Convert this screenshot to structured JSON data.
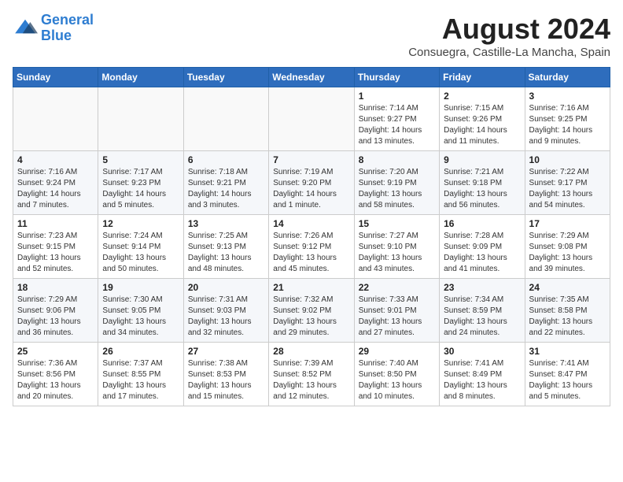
{
  "logo": {
    "line1": "General",
    "line2": "Blue"
  },
  "title": "August 2024",
  "subtitle": "Consuegra, Castille-La Mancha, Spain",
  "days_header": [
    "Sunday",
    "Monday",
    "Tuesday",
    "Wednesday",
    "Thursday",
    "Friday",
    "Saturday"
  ],
  "weeks": [
    [
      {
        "day": "",
        "info": ""
      },
      {
        "day": "",
        "info": ""
      },
      {
        "day": "",
        "info": ""
      },
      {
        "day": "",
        "info": ""
      },
      {
        "day": "1",
        "info": "Sunrise: 7:14 AM\nSunset: 9:27 PM\nDaylight: 14 hours\nand 13 minutes."
      },
      {
        "day": "2",
        "info": "Sunrise: 7:15 AM\nSunset: 9:26 PM\nDaylight: 14 hours\nand 11 minutes."
      },
      {
        "day": "3",
        "info": "Sunrise: 7:16 AM\nSunset: 9:25 PM\nDaylight: 14 hours\nand 9 minutes."
      }
    ],
    [
      {
        "day": "4",
        "info": "Sunrise: 7:16 AM\nSunset: 9:24 PM\nDaylight: 14 hours\nand 7 minutes."
      },
      {
        "day": "5",
        "info": "Sunrise: 7:17 AM\nSunset: 9:23 PM\nDaylight: 14 hours\nand 5 minutes."
      },
      {
        "day": "6",
        "info": "Sunrise: 7:18 AM\nSunset: 9:21 PM\nDaylight: 14 hours\nand 3 minutes."
      },
      {
        "day": "7",
        "info": "Sunrise: 7:19 AM\nSunset: 9:20 PM\nDaylight: 14 hours\nand 1 minute."
      },
      {
        "day": "8",
        "info": "Sunrise: 7:20 AM\nSunset: 9:19 PM\nDaylight: 13 hours\nand 58 minutes."
      },
      {
        "day": "9",
        "info": "Sunrise: 7:21 AM\nSunset: 9:18 PM\nDaylight: 13 hours\nand 56 minutes."
      },
      {
        "day": "10",
        "info": "Sunrise: 7:22 AM\nSunset: 9:17 PM\nDaylight: 13 hours\nand 54 minutes."
      }
    ],
    [
      {
        "day": "11",
        "info": "Sunrise: 7:23 AM\nSunset: 9:15 PM\nDaylight: 13 hours\nand 52 minutes."
      },
      {
        "day": "12",
        "info": "Sunrise: 7:24 AM\nSunset: 9:14 PM\nDaylight: 13 hours\nand 50 minutes."
      },
      {
        "day": "13",
        "info": "Sunrise: 7:25 AM\nSunset: 9:13 PM\nDaylight: 13 hours\nand 48 minutes."
      },
      {
        "day": "14",
        "info": "Sunrise: 7:26 AM\nSunset: 9:12 PM\nDaylight: 13 hours\nand 45 minutes."
      },
      {
        "day": "15",
        "info": "Sunrise: 7:27 AM\nSunset: 9:10 PM\nDaylight: 13 hours\nand 43 minutes."
      },
      {
        "day": "16",
        "info": "Sunrise: 7:28 AM\nSunset: 9:09 PM\nDaylight: 13 hours\nand 41 minutes."
      },
      {
        "day": "17",
        "info": "Sunrise: 7:29 AM\nSunset: 9:08 PM\nDaylight: 13 hours\nand 39 minutes."
      }
    ],
    [
      {
        "day": "18",
        "info": "Sunrise: 7:29 AM\nSunset: 9:06 PM\nDaylight: 13 hours\nand 36 minutes."
      },
      {
        "day": "19",
        "info": "Sunrise: 7:30 AM\nSunset: 9:05 PM\nDaylight: 13 hours\nand 34 minutes."
      },
      {
        "day": "20",
        "info": "Sunrise: 7:31 AM\nSunset: 9:03 PM\nDaylight: 13 hours\nand 32 minutes."
      },
      {
        "day": "21",
        "info": "Sunrise: 7:32 AM\nSunset: 9:02 PM\nDaylight: 13 hours\nand 29 minutes."
      },
      {
        "day": "22",
        "info": "Sunrise: 7:33 AM\nSunset: 9:01 PM\nDaylight: 13 hours\nand 27 minutes."
      },
      {
        "day": "23",
        "info": "Sunrise: 7:34 AM\nSunset: 8:59 PM\nDaylight: 13 hours\nand 24 minutes."
      },
      {
        "day": "24",
        "info": "Sunrise: 7:35 AM\nSunset: 8:58 PM\nDaylight: 13 hours\nand 22 minutes."
      }
    ],
    [
      {
        "day": "25",
        "info": "Sunrise: 7:36 AM\nSunset: 8:56 PM\nDaylight: 13 hours\nand 20 minutes."
      },
      {
        "day": "26",
        "info": "Sunrise: 7:37 AM\nSunset: 8:55 PM\nDaylight: 13 hours\nand 17 minutes."
      },
      {
        "day": "27",
        "info": "Sunrise: 7:38 AM\nSunset: 8:53 PM\nDaylight: 13 hours\nand 15 minutes."
      },
      {
        "day": "28",
        "info": "Sunrise: 7:39 AM\nSunset: 8:52 PM\nDaylight: 13 hours\nand 12 minutes."
      },
      {
        "day": "29",
        "info": "Sunrise: 7:40 AM\nSunset: 8:50 PM\nDaylight: 13 hours\nand 10 minutes."
      },
      {
        "day": "30",
        "info": "Sunrise: 7:41 AM\nSunset: 8:49 PM\nDaylight: 13 hours\nand 8 minutes."
      },
      {
        "day": "31",
        "info": "Sunrise: 7:41 AM\nSunset: 8:47 PM\nDaylight: 13 hours\nand 5 minutes."
      }
    ]
  ]
}
